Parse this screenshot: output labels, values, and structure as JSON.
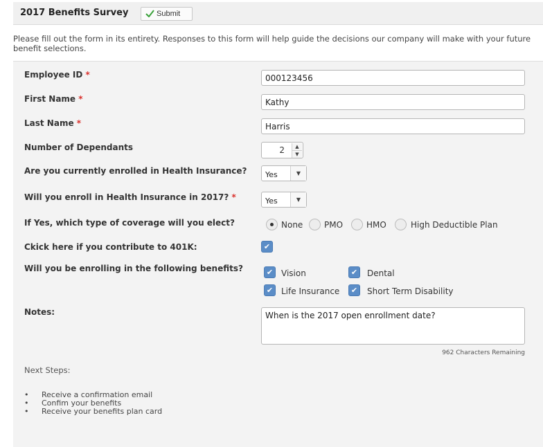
{
  "header": {
    "title": "2017 Benefits Survey",
    "submit_label": "Submit"
  },
  "intro_text": "Please fill out the form in its entirety. Responses to this form will help guide the decisions our company will make with your future benefit selections.",
  "fields": {
    "employee_id": {
      "label": "Employee ID",
      "required_mark": "*",
      "value": "000123456"
    },
    "first_name": {
      "label": "First Name",
      "required_mark": "*",
      "value": "Kathy"
    },
    "last_name": {
      "label": "Last Name",
      "required_mark": "*",
      "value": "Harris"
    },
    "dependants": {
      "label": "Number of Dependants",
      "value": "2"
    },
    "health_enrolled": {
      "label": "Are you currently enrolled in Health Insurance?",
      "value": "Yes"
    },
    "health_2017": {
      "label": "Will you enroll in Health Insurance in 2017?",
      "required_mark": "*",
      "value": "Yes"
    },
    "coverage": {
      "label": "If Yes, which type of coverage will you elect?",
      "options": [
        "None",
        "PMO",
        "HMO",
        "High Deductible Plan"
      ],
      "selected": "None"
    },
    "contribute_401k": {
      "label": "Ckick here if you contribute to 401K:",
      "checked": true
    },
    "benefits": {
      "label": "Will you be enrolling in the following benefits?",
      "options": [
        "Vision",
        "Dental",
        "Life Insurance",
        "Short Term Disability"
      ],
      "checked": [
        true,
        true,
        true,
        true
      ]
    },
    "notes": {
      "label": "Notes:",
      "value": "When is the 2017 open enrollment date?",
      "remaining": "962 Characters Remaining"
    }
  },
  "next_steps": {
    "title": "Next Steps:",
    "items": [
      "Receive a confirmation email",
      "Confim your benefits",
      "Receive your benefits plan card"
    ]
  },
  "colors": {
    "checkbox_accent": "#5b8dc7",
    "submit_check": "#3aa13a",
    "required_mark": "#d9302c",
    "panel_bg": "#f3f3f3"
  }
}
